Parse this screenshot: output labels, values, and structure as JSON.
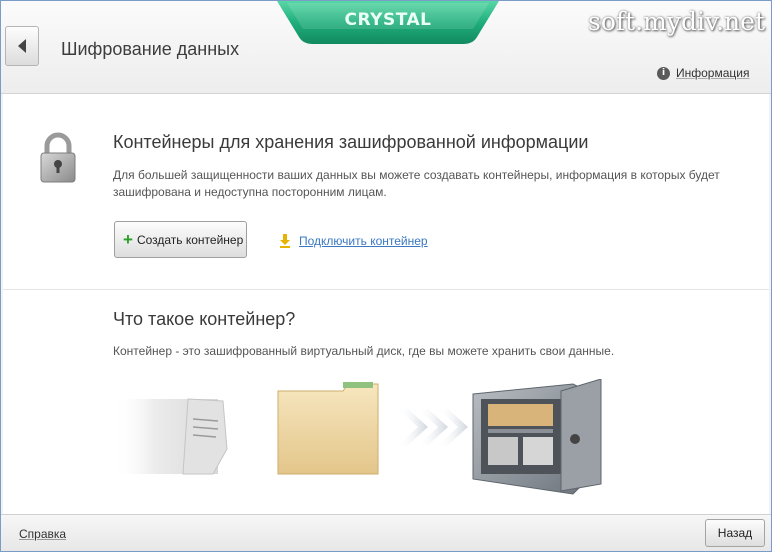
{
  "header": {
    "title": "Шифрование данных",
    "brand": "CRYSTAL",
    "info_label": "Информация"
  },
  "watermark": "soft.mydiv.net",
  "section_containers": {
    "heading": "Контейнеры для хранения зашифрованной информации",
    "description": "Для большей защищенности ваших данных вы можете создавать контейнеры, информация в которых будет зашифрована и недоступна посторонним лицам.",
    "create_button": "Создать контейнер",
    "connect_link": "Подключить контейнер"
  },
  "section_what": {
    "heading": "Что такое контейнер?",
    "description": "Контейнер - это зашифрованный виртуальный диск, где вы можете хранить свои данные."
  },
  "footer": {
    "help_label": "Справка",
    "back_label": "Назад"
  },
  "icons": [
    "back-arrow-icon",
    "info-icon",
    "lock-icon",
    "plus-icon",
    "download-arrow-icon",
    "document-icon",
    "folder-icon",
    "chevrons-icon",
    "safe-icon"
  ],
  "colors": {
    "brand_green": "#1fae7c",
    "link_blue": "#3a78c2",
    "plus_green": "#2aa02a"
  }
}
